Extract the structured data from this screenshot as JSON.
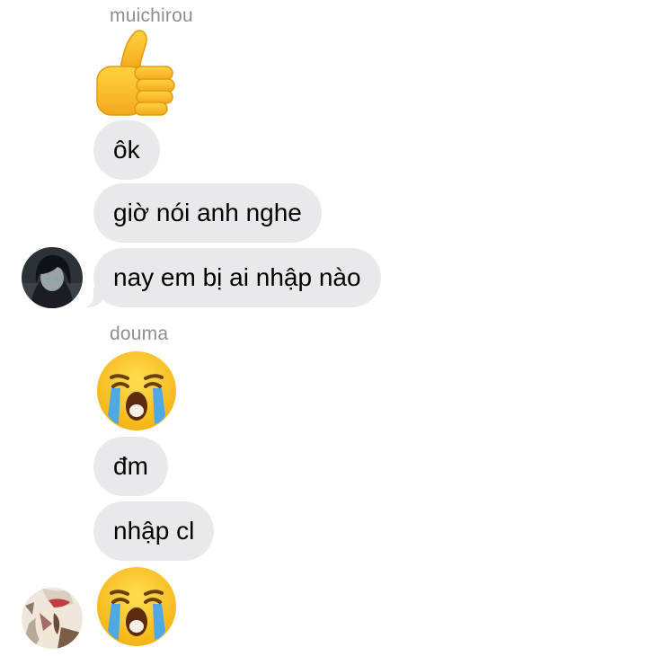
{
  "messages": {
    "group1": {
      "sender": "muichirou",
      "bubbles": [
        "ôk",
        "giờ nói anh nghe",
        "nay em bị ai nhập nào"
      ],
      "reaction_icon": "thumbs-up-emoji"
    },
    "group2": {
      "sender": "douma",
      "bubbles": [
        "đm",
        "nhập cl"
      ],
      "reaction_icon": "loudly-crying-face-emoji"
    }
  },
  "colors": {
    "bubble_bg": "#e9e9eb",
    "sender_name": "#8e8e93",
    "emoji_yellow": "#fcc21b",
    "tear_blue": "#4fa8e6"
  }
}
